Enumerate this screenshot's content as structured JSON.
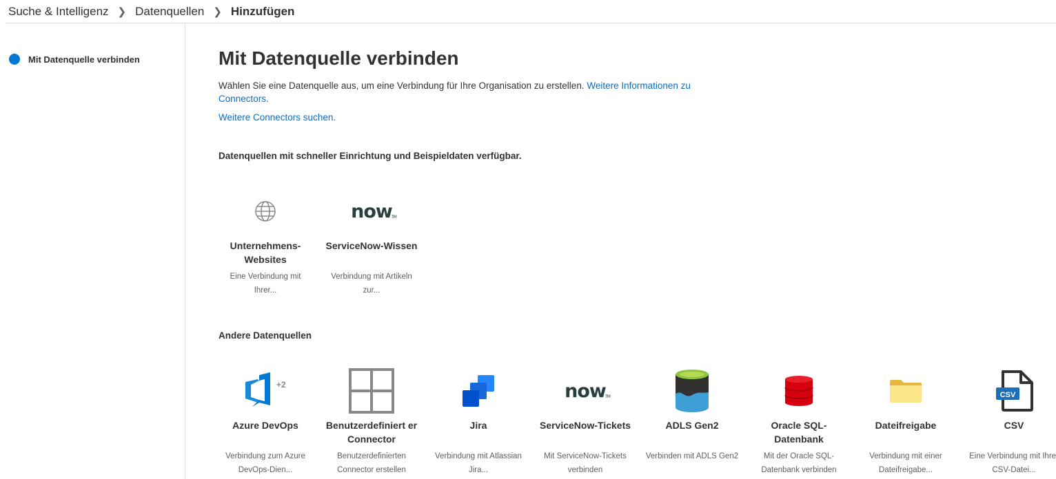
{
  "breadcrumb": {
    "items": [
      "Suche & Intelligenz",
      "Datenquellen"
    ],
    "current": "Hinzufügen"
  },
  "sidebar": {
    "step_label": "Mit Datenquelle verbinden"
  },
  "main": {
    "title": "Mit Datenquelle verbinden",
    "description": "Wählen Sie eine Datenquelle aus, um eine Verbindung für Ihre Organisation zu erstellen.",
    "learn_more_link": "Weitere Informationen zu Connectors.",
    "search_connectors_link": "Weitere Connectors suchen.",
    "quick_section_title": "Datenquellen mit schneller Einrichtung und Beispieldaten verfügbar.",
    "other_section_title": "Andere Datenquellen",
    "quick_tiles": [
      {
        "name": "Unternehmens-Websites",
        "desc": "Eine Verbindung mit Ihrer...",
        "icon": "globe-icon"
      },
      {
        "name": "ServiceNow-Wissen",
        "desc": "Verbindung mit Artikeln zur...",
        "icon": "servicenow-logo",
        "logo_text": "now",
        "logo_tm": "TM"
      }
    ],
    "other_tiles": [
      {
        "name": "Azure DevOps",
        "desc": "Verbindung zum Azure DevOps-Dien...",
        "icon": "azure-devops-icon",
        "badge": "+2"
      },
      {
        "name": "Benutzerdefiniert er Connector",
        "desc": "Benutzerdefinierten Connector erstellen",
        "icon": "custom-connector-icon"
      },
      {
        "name": "Jira",
        "desc": "Verbindung mit Atlassian Jira...",
        "icon": "jira-icon"
      },
      {
        "name": "ServiceNow-Tickets",
        "desc": "Mit ServiceNow-Tickets verbinden",
        "icon": "servicenow-logo",
        "logo_text": "now",
        "logo_tm": "TM"
      },
      {
        "name": "ADLS Gen2",
        "desc": "Verbinden mit ADLS Gen2",
        "icon": "adls-gen2-icon"
      },
      {
        "name": "Oracle SQL-Datenbank",
        "desc": "Mit der Oracle SQL-Datenbank verbinden",
        "icon": "oracle-database-icon"
      },
      {
        "name": "Dateifreigabe",
        "desc": "Verbindung mit einer Dateifreigabe...",
        "icon": "folder-icon"
      },
      {
        "name": "CSV",
        "desc": "Eine Verbindung mit Ihrer CSV-Datei...",
        "icon": "csv-file-icon",
        "badge": "CSV"
      }
    ]
  }
}
